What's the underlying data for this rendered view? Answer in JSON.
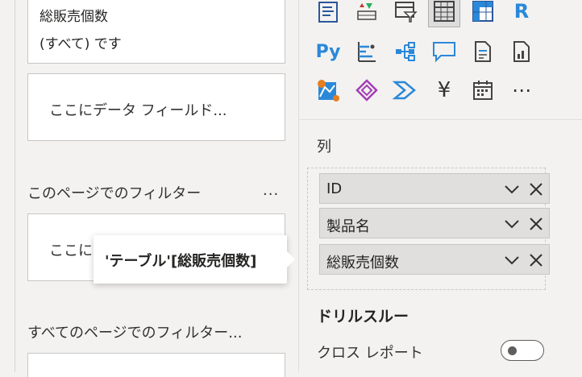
{
  "filters": {
    "top_card": {
      "title": "総販売個数",
      "value": "(すべて) です"
    },
    "drop_placeholder_1": "ここにデータ フィールド...",
    "page_filters_title": "このページでのフィルター",
    "more_label": "...",
    "drop_placeholder_2": "ここに",
    "all_pages_filters_title": "すべてのページでのフィルター..."
  },
  "tooltip": {
    "text": "'テーブル'[総販売個数]"
  },
  "visualizations": {
    "icons": [
      "text-box-icon",
      "waterfall-icon",
      "table-filter-icon",
      "table-icon",
      "matrix-icon",
      "r-script-icon",
      "python-icon",
      "key-influencers-icon",
      "decomposition-tree-icon",
      "qa-icon",
      "paginated-report-icon",
      "smart-narrative-icon",
      "azure-map-icon",
      "power-apps-icon",
      "power-automate-icon",
      "yen-icon",
      "calendar-icon",
      "more-visuals-icon"
    ],
    "r_label": "R",
    "py_label": "Py",
    "yen_label": "¥",
    "more_label": "⋯",
    "columns_label": "列",
    "fields": [
      {
        "label": "ID"
      },
      {
        "label": "製品名"
      },
      {
        "label": "総販売個数"
      }
    ],
    "drillthrough_title": "ドリルスルー",
    "cross_report_label": "クロス レポート",
    "cross_report_on": false
  }
}
